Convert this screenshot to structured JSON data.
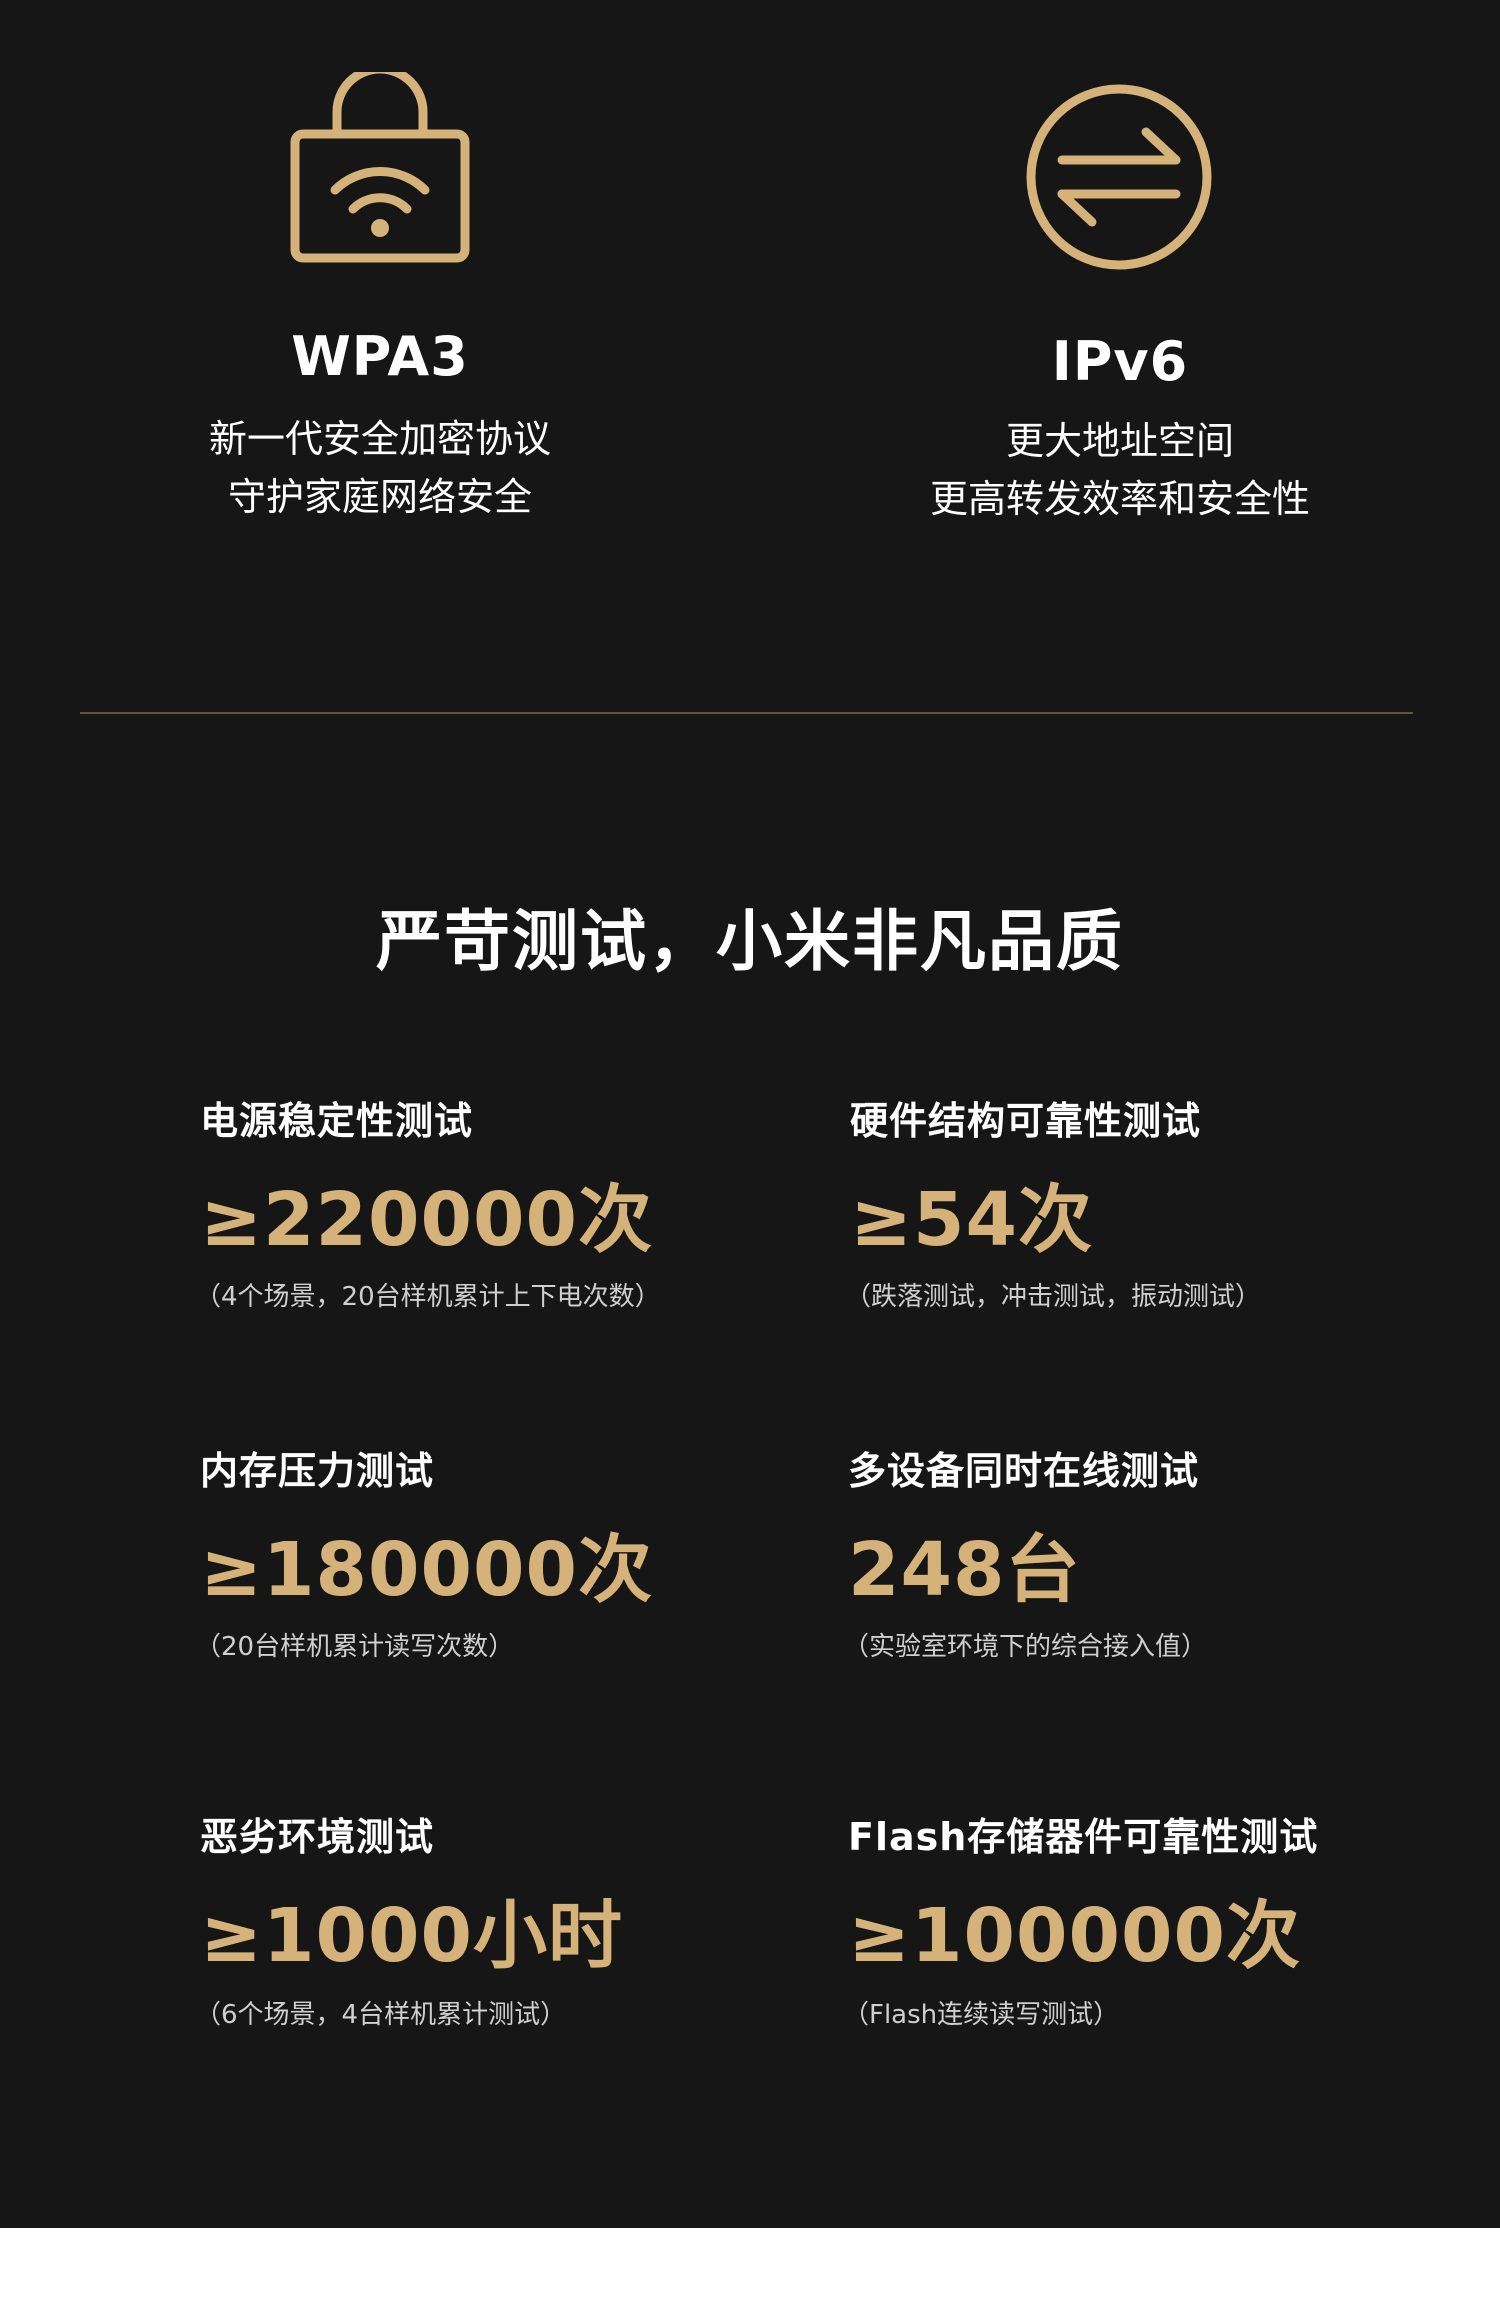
{
  "colors": {
    "background": "#161616",
    "gold": "#d4b27a",
    "divider": "#5f5341",
    "text": "#ffffff"
  },
  "features": [
    {
      "icon": "wifi-lock-icon",
      "title": "WPA3",
      "desc_line1": "新一代安全加密协议",
      "desc_line2": "守护家庭网络安全"
    },
    {
      "icon": "exchange-arrows-icon",
      "title": "IPv6",
      "desc_line1": "更大地址空间",
      "desc_line2": "更高转发效率和安全性"
    }
  ],
  "section_title": "严苛测试，小米非凡品质",
  "tests": [
    {
      "label": "电源稳定性测试",
      "value": "≥220000次",
      "note": "（4个场景，20台样机累计上下电次数）"
    },
    {
      "label": "硬件结构可靠性测试",
      "value": "≥54次",
      "note": "（跌落测试，冲击测试，振动测试）"
    },
    {
      "label": "内存压力测试",
      "value": "≥180000次",
      "note": "（20台样机累计读写次数）"
    },
    {
      "label": "多设备同时在线测试",
      "value": "248台",
      "note": "（实验室环境下的综合接入值）"
    },
    {
      "label": "恶劣环境测试",
      "value": "≥1000小时",
      "note": "（6个场景，4台样机累计测试）"
    },
    {
      "label": "Flash存储器件可靠性测试",
      "value": "≥100000次",
      "note": "（Flash连续读写测试）"
    }
  ]
}
